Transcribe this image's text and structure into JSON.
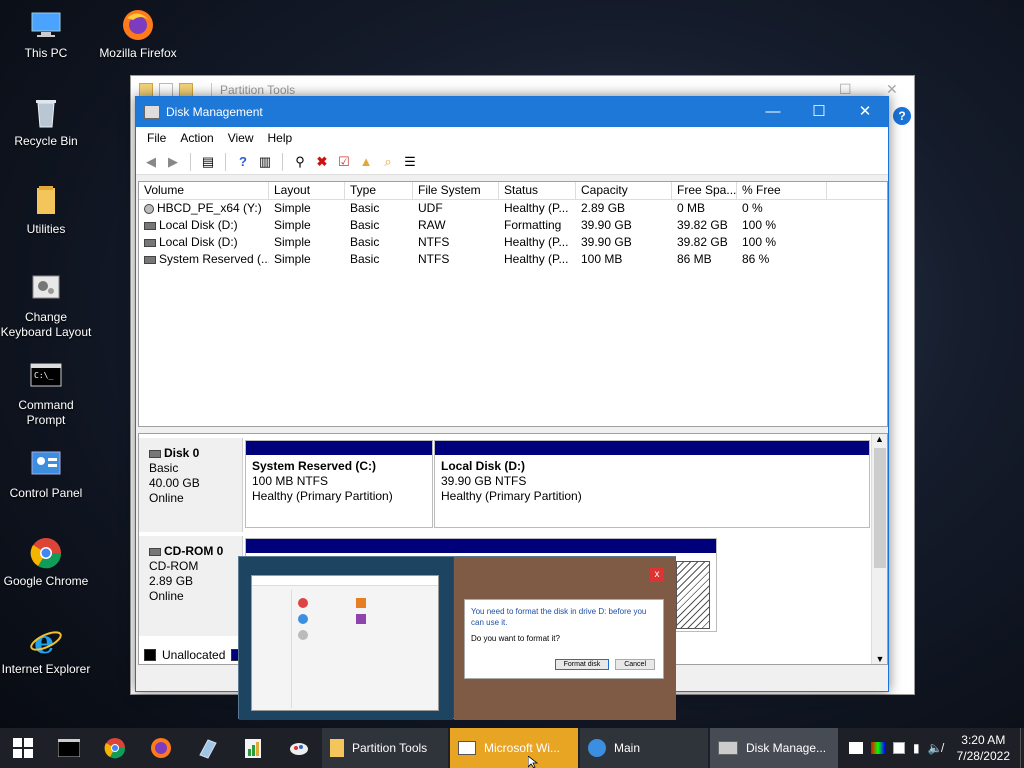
{
  "desktop": {
    "icons": [
      {
        "label": "This PC"
      },
      {
        "label": "Mozilla Firefox"
      },
      {
        "label": "Recycle Bin"
      },
      {
        "label": "Utilities"
      },
      {
        "label": "Change Keyboard Layout"
      },
      {
        "label": "Command Prompt"
      },
      {
        "label": "Control Panel"
      },
      {
        "label": "Google Chrome"
      },
      {
        "label": "Internet Explorer"
      }
    ]
  },
  "bg_window": {
    "title": "Partition Tools",
    "help": "?"
  },
  "dm": {
    "title": "Disk Management",
    "menu": [
      "File",
      "Action",
      "View",
      "Help"
    ],
    "columns": [
      "Volume",
      "Layout",
      "Type",
      "File System",
      "Status",
      "Capacity",
      "Free Spa...",
      "% Free"
    ],
    "rows": [
      [
        "HBCD_PE_x64 (Y:)",
        "Simple",
        "Basic",
        "UDF",
        "Healthy (P...",
        "2.89 GB",
        "0 MB",
        "0 %"
      ],
      [
        "Local Disk (D:)",
        "Simple",
        "Basic",
        "RAW",
        "Formatting",
        "39.90 GB",
        "39.82 GB",
        "100 %"
      ],
      [
        "Local Disk (D:)",
        "Simple",
        "Basic",
        "NTFS",
        "Healthy (P...",
        "39.90 GB",
        "39.82 GB",
        "100 %"
      ],
      [
        "System Reserved (...",
        "Simple",
        "Basic",
        "NTFS",
        "Healthy (P...",
        "100 MB",
        "86 MB",
        "86 %"
      ]
    ],
    "disk0": {
      "name": "Disk 0",
      "type": "Basic",
      "size": "40.00 GB",
      "state": "Online",
      "p1": {
        "name": "System Reserved  (C:)",
        "size": "100 MB NTFS",
        "status": "Healthy (Primary Partition)"
      },
      "p2": {
        "name": "Local Disk  (D:)",
        "size": "39.90 GB NTFS",
        "status": "Healthy (Primary Partition)"
      }
    },
    "cdrom": {
      "name": "CD-ROM 0",
      "type": "CD-ROM",
      "size": "2.89 GB",
      "state": "Online"
    },
    "legend": {
      "unallocated": "Unallocated"
    }
  },
  "preview": {
    "message": "You need to format the disk in drive D: before you can use it.",
    "question": "Do you want to format it?",
    "format_btn": "Format disk",
    "cancel_btn": "Cancel",
    "close": "x"
  },
  "taskbar": {
    "buttons": [
      {
        "label": "Partition Tools"
      },
      {
        "label": "Microsoft Wi..."
      },
      {
        "label": "Main"
      },
      {
        "label": "Disk Manage..."
      }
    ],
    "time": "3:20 AM",
    "date": "7/28/2022"
  }
}
